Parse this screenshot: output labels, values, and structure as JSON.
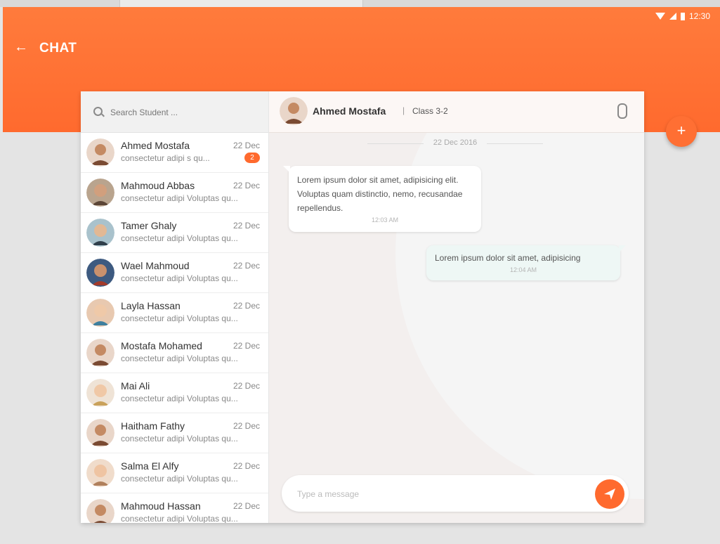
{
  "status_bar": {
    "time": "12:30",
    "icons": [
      "wifi-icon",
      "signal-icon",
      "battery-icon"
    ]
  },
  "header": {
    "back_icon": "arrow-left-icon",
    "title": "CHAT",
    "fab_label": "+"
  },
  "search": {
    "placeholder": "Search Student ..."
  },
  "contacts": [
    {
      "name": "Ahmed Mostafa",
      "date": "22 Dec",
      "preview": "consectetur adipi s qu...",
      "unread": "2"
    },
    {
      "name": "Mahmoud Abbas",
      "date": "22 Dec",
      "preview": "consectetur adipi Voluptas qu..."
    },
    {
      "name": "Tamer Ghaly",
      "date": "22 Dec",
      "preview": "consectetur adipi Voluptas qu..."
    },
    {
      "name": "Wael Mahmoud",
      "date": "22 Dec",
      "preview": "consectetur adipi Voluptas qu..."
    },
    {
      "name": "Layla Hassan",
      "date": "22 Dec",
      "preview": "consectetur adipi Voluptas qu..."
    },
    {
      "name": "Mostafa Mohamed",
      "date": "22 Dec",
      "preview": "consectetur adipi Voluptas qu..."
    },
    {
      "name": "Mai Ali",
      "date": "22 Dec",
      "preview": "consectetur adipi Voluptas qu..."
    },
    {
      "name": "Haitham Fathy",
      "date": "22 Dec",
      "preview": "consectetur adipi Voluptas qu..."
    },
    {
      "name": "Salma El Alfy",
      "date": "22 Dec",
      "preview": "consectetur adipi Voluptas qu..."
    },
    {
      "name": "Mahmoud Hassan",
      "date": "22 Dec",
      "preview": "consectetur adipi Voluptas qu..."
    }
  ],
  "chat": {
    "name": "Ahmed Mostafa",
    "separator": "|",
    "class": "Class 3-2",
    "date_divider": "22 Dec 2016",
    "messages": [
      {
        "direction": "in",
        "text": "Lorem ipsum dolor sit amet, adipisicing elit. Voluptas quam distinctio, nemo, recusandae repellendus.",
        "time": "12:03 AM"
      },
      {
        "direction": "out",
        "text": "Lorem ipsum dolor sit amet, adipisicing",
        "time": "12:04 AM"
      }
    ],
    "composer_placeholder": "Type a message"
  },
  "colors": {
    "accent": "#ff6a2e",
    "header": "#ff7b3c",
    "background": "#e4e4e4"
  }
}
